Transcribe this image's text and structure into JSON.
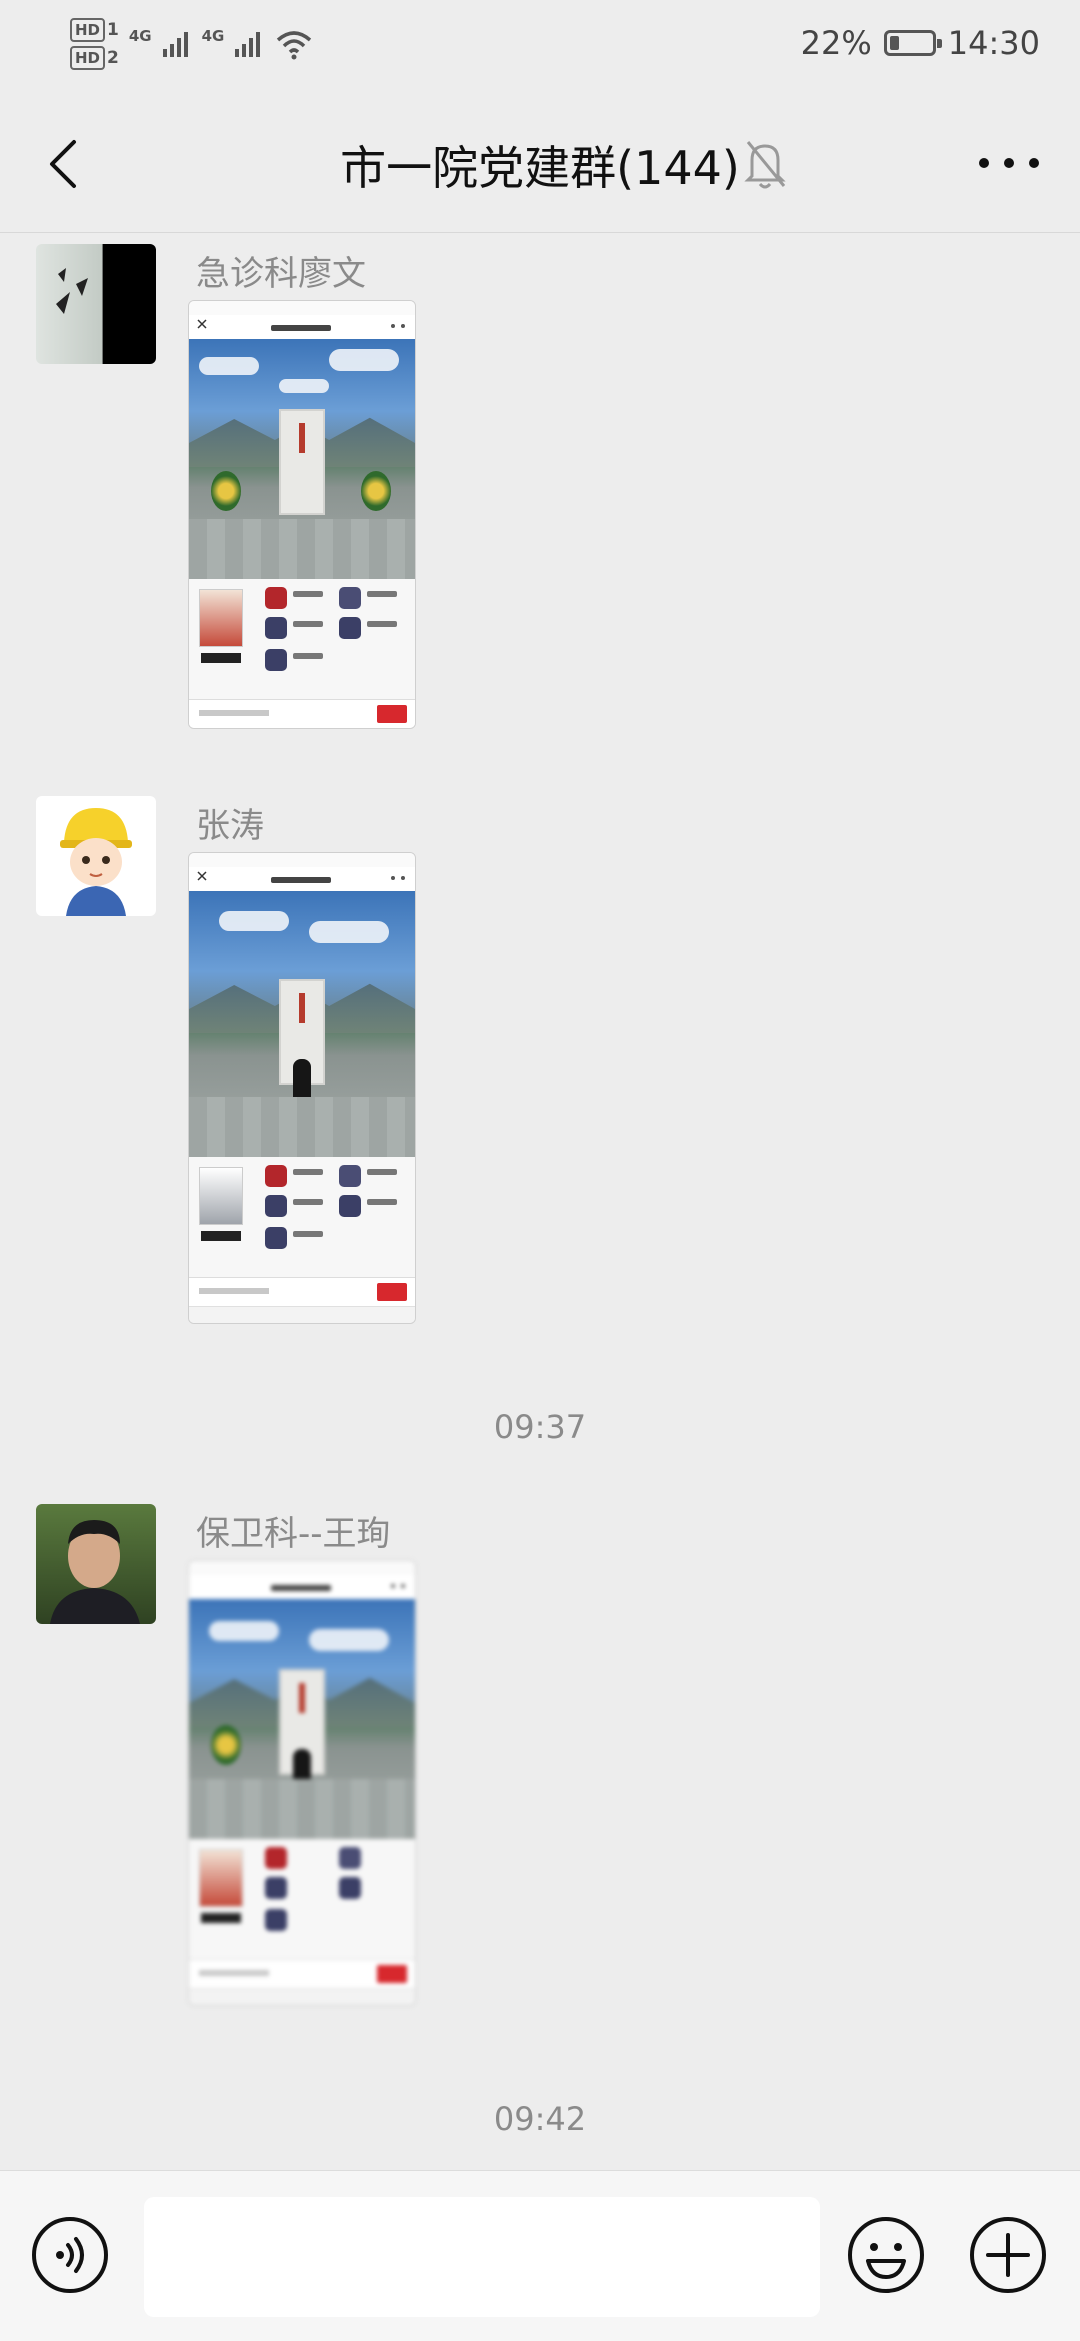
{
  "status_bar": {
    "hd1": "HD",
    "hd1_sub": "1",
    "hd2": "HD",
    "hd2_sub": "2",
    "net1": "4G",
    "net2": "4G",
    "battery": "22%",
    "battery_level": 0.22,
    "time": "14:30"
  },
  "header": {
    "title": "市一院党建群(144)",
    "back_icon": "chevron-left-icon",
    "mute_icon": "bell-off-icon",
    "more_icon": "ellipsis-icon"
  },
  "messages": [
    {
      "sender": "急诊科廖文",
      "type": "image"
    },
    {
      "sender": "张涛",
      "type": "image"
    },
    {
      "sender": "保卫科--王珣",
      "type": "image"
    }
  ],
  "timestamps": [
    "09:37",
    "09:42"
  ],
  "composer": {
    "voice_icon": "voice-icon",
    "input_value": "",
    "emoji_icon": "emoji-icon",
    "plus_icon": "plus-icon"
  }
}
